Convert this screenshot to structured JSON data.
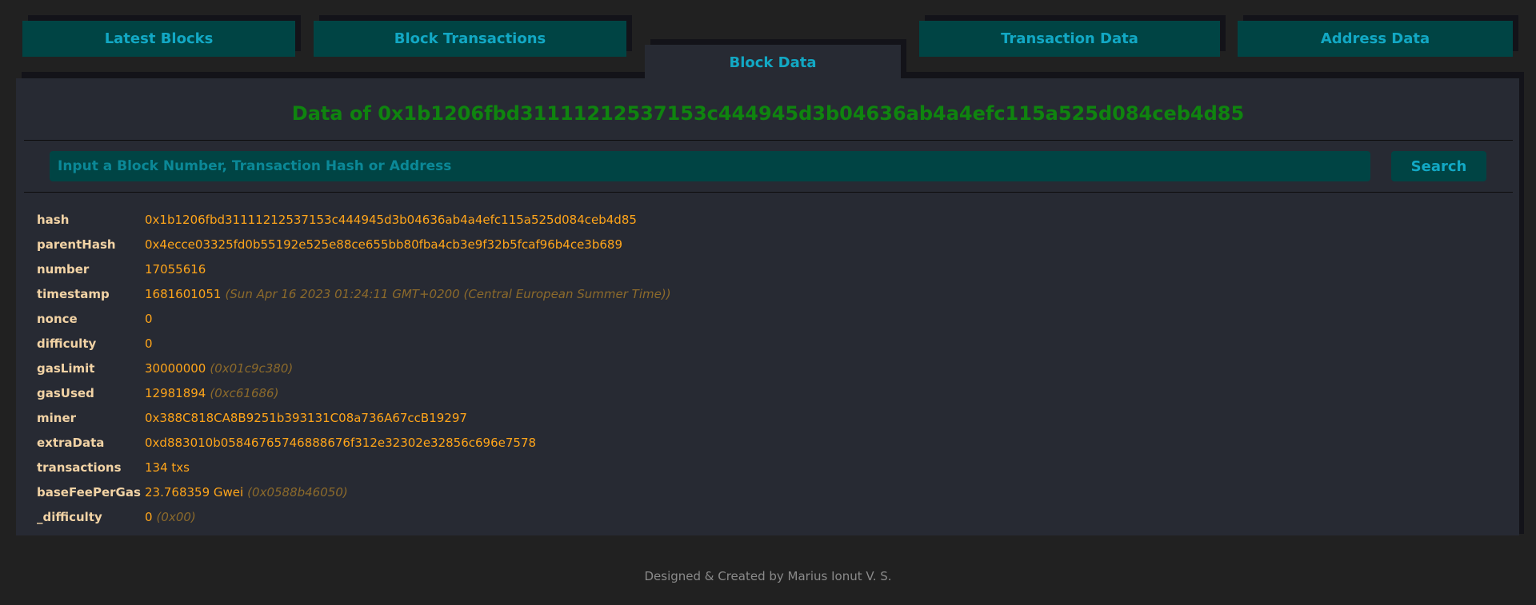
{
  "tabs": {
    "latest_blocks": "Latest Blocks",
    "block_transactions": "Block Transactions",
    "block_data": "Block Data",
    "transaction_data": "Transaction Data",
    "address_data": "Address Data"
  },
  "active_tab": "Block Data",
  "title": "Data of 0x1b1206fbd31111212537153c444945d3b04636ab4a4efc115a525d084ceb4d85",
  "search": {
    "placeholder": "Input a Block Number, Transaction Hash or Address",
    "value": "",
    "button_label": "Search"
  },
  "block": [
    {
      "key": "hash",
      "value": "0x1b1206fbd31111212537153c444945d3b04636ab4a4efc115a525d084ceb4d85",
      "note": ""
    },
    {
      "key": "parentHash",
      "value": "0x4ecce03325fd0b55192e525e88ce655bb80fba4cb3e9f32b5fcaf96b4ce3b689",
      "note": ""
    },
    {
      "key": "number",
      "value": "17055616",
      "note": ""
    },
    {
      "key": "timestamp",
      "value": "1681601051",
      "note": "(Sun Apr 16 2023 01:24:11 GMT+0200 (Central European Summer Time))"
    },
    {
      "key": "nonce",
      "value": "0",
      "note": ""
    },
    {
      "key": "difficulty",
      "value": "0",
      "note": ""
    },
    {
      "key": "gasLimit",
      "value": "30000000",
      "note": "(0x01c9c380)"
    },
    {
      "key": "gasUsed",
      "value": "12981894",
      "note": "(0xc61686)"
    },
    {
      "key": "miner",
      "value": "0x388C818CA8B9251b393131C08a736A67ccB19297",
      "note": ""
    },
    {
      "key": "extraData",
      "value": "0xd883010b05846765746888676f312e32302e32856c696e7578",
      "note": ""
    },
    {
      "key": "transactions",
      "value": "134 txs",
      "note": ""
    },
    {
      "key": "baseFeePerGas",
      "value": "23.768359 Gwei",
      "note": "(0x0588b46050)"
    },
    {
      "key": "_difficulty",
      "value": "0",
      "note": "(0x00)"
    }
  ],
  "footer": "Designed & Created by Marius Ionut V. S.",
  "colors": {
    "background": "#212121",
    "panel": "#272a33",
    "tab": "#004444",
    "accent": "#12a8c4",
    "title": "#0f840f",
    "key": "#f2d3a5",
    "value": "#ffa51a",
    "note": "#8c6a2b"
  }
}
